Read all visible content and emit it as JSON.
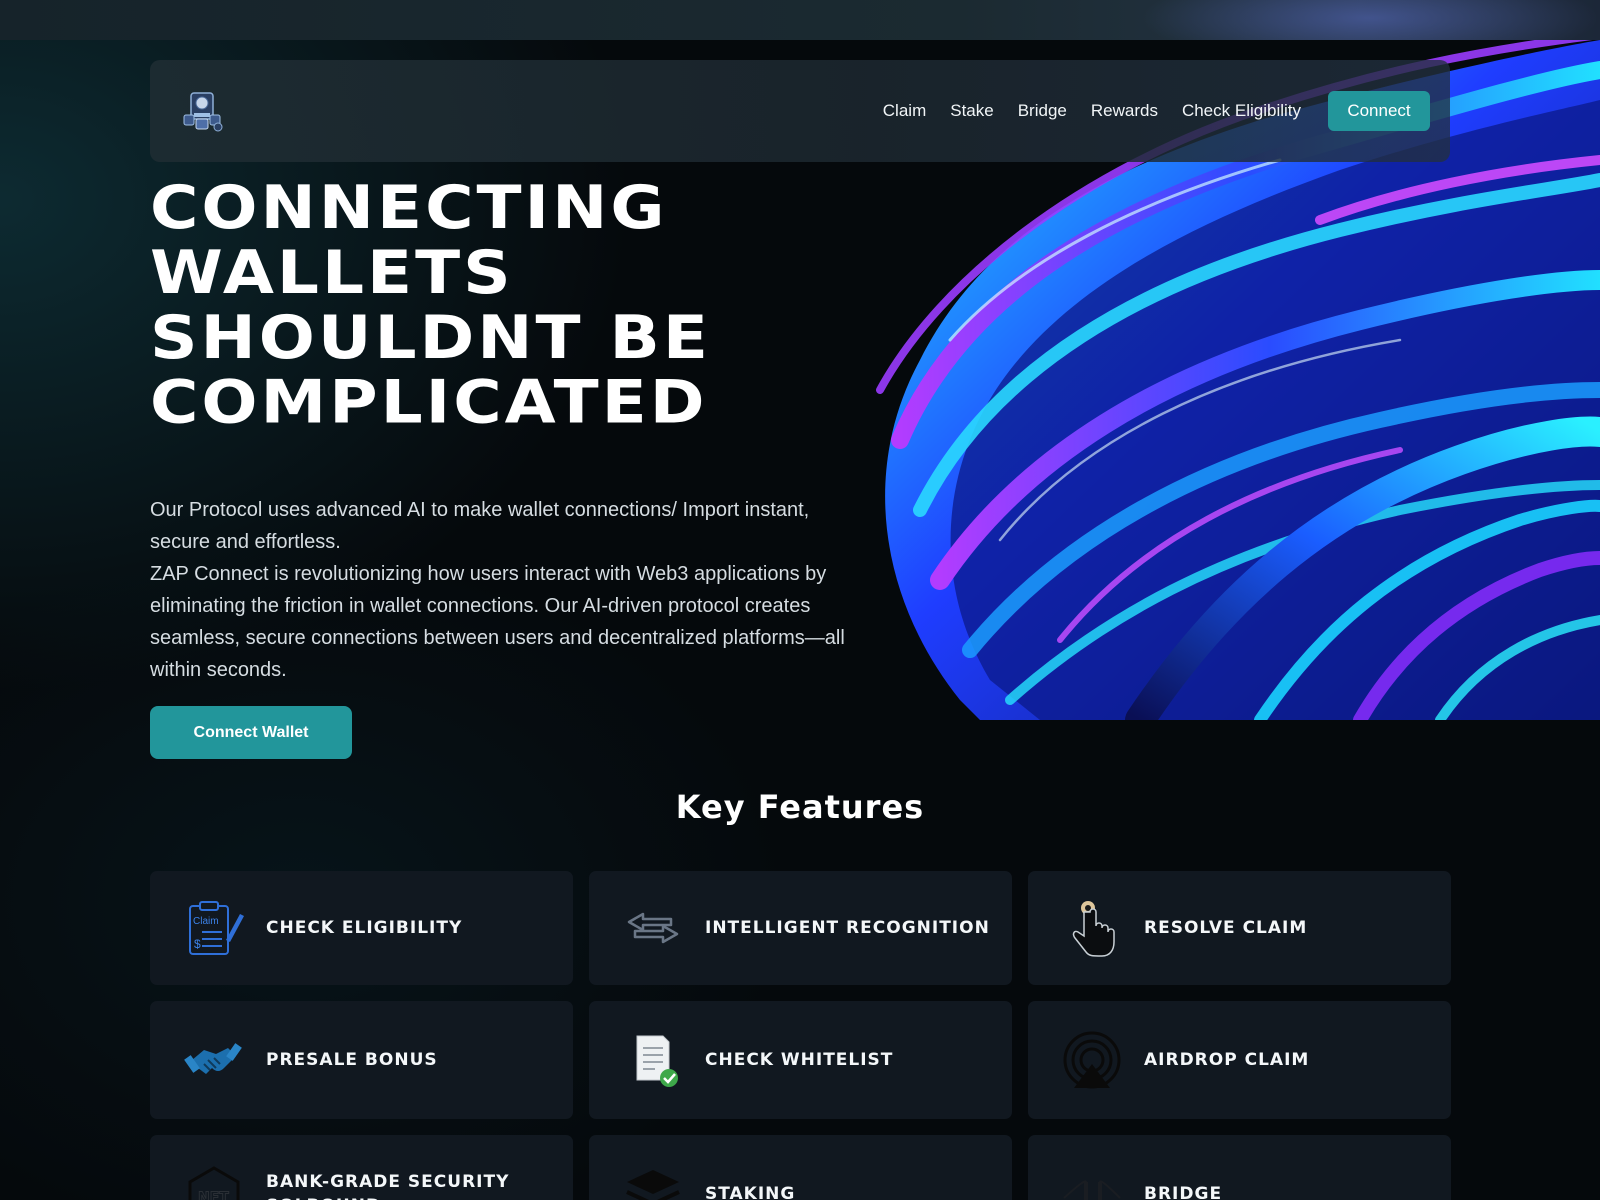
{
  "nav": {
    "logo_icon": "robot-logo-icon",
    "links": [
      "Claim",
      "Stake",
      "Bridge",
      "Rewards",
      "Check Eligibility"
    ],
    "connect_label": "Connect"
  },
  "hero": {
    "title_lines": [
      "CONNECTING",
      "WALLETS",
      "SHOULDNT BE",
      "COMPLICATED"
    ],
    "paragraph_1": "Our Protocol uses advanced AI to make wallet connections/ Import instant, secure and effortless.",
    "paragraph_2": "ZAP Connect is revolutionizing how users interact with Web3 applications by eliminating the friction in wallet connections. Our AI-driven protocol creates seamless, secure connections between users and decentralized platforms—all within seconds.",
    "cta_label": "Connect Wallet"
  },
  "features": {
    "title": "Key Features",
    "items": [
      {
        "label": "CHECK ELIGIBILITY",
        "icon": "claim-clipboard-icon"
      },
      {
        "label": "INTELLIGENT RECOGNITION",
        "icon": "swap-arrows-icon"
      },
      {
        "label": "RESOLVE CLAIM",
        "icon": "tap-hand-icon"
      },
      {
        "label": "PRESALE BONUS",
        "icon": "handshake-icon"
      },
      {
        "label": "CHECK WHITELIST",
        "icon": "document-check-icon"
      },
      {
        "label": "AIRDROP CLAIM",
        "icon": "airdrop-signal-icon"
      },
      {
        "label": "BANK-GRADE SECURITY SOLBOUND",
        "icon": "nft-hexagon-icon"
      },
      {
        "label": "STAKING",
        "icon": "stack-layers-icon"
      },
      {
        "label": "BRIDGE",
        "icon": "bridge-icon"
      }
    ]
  },
  "colors": {
    "accent": "#22969b",
    "background": "#05090c",
    "card": "#111820"
  }
}
